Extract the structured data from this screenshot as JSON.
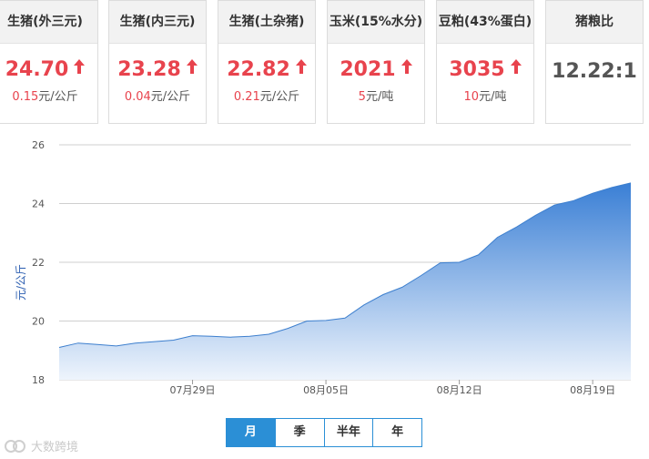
{
  "cards": [
    {
      "name": "生猪(外三元)",
      "price": "24.70",
      "change": "0.15",
      "unit": "元/公斤",
      "trend": "up"
    },
    {
      "name": "生猪(内三元)",
      "price": "23.28",
      "change": "0.04",
      "unit": "元/公斤",
      "trend": "up"
    },
    {
      "name": "生猪(土杂猪)",
      "price": "22.82",
      "change": "0.21",
      "unit": "元/公斤",
      "trend": "up"
    },
    {
      "name": "玉米(15%水分)",
      "price": "2021",
      "change": "5",
      "unit": "元/吨",
      "trend": "up"
    },
    {
      "name": "豆粕(43%蛋白)",
      "price": "3035",
      "change": "10",
      "unit": "元/吨",
      "trend": "up"
    }
  ],
  "ratio_card": {
    "name": "猪粮比",
    "value": "12.22:1"
  },
  "colors": {
    "up": "#e8434d",
    "line": "#3d7fce",
    "fill_top": "#3a7fd5",
    "fill_bottom": "#eef4fc",
    "tab_active": "#2b8fd6"
  },
  "chart_data": {
    "type": "area",
    "ylabel": "元/公斤",
    "ylim": [
      18,
      26
    ],
    "yticks": [
      18,
      20,
      22,
      24,
      26
    ],
    "xticks": [
      {
        "label": "07月29日",
        "index": 7
      },
      {
        "label": "08月05日",
        "index": 14
      },
      {
        "label": "08月12日",
        "index": 21
      },
      {
        "label": "08月19日",
        "index": 28
      }
    ],
    "series": [
      {
        "values": [
          19.1,
          19.25,
          19.2,
          19.15,
          19.25,
          19.3,
          19.35,
          19.5,
          19.48,
          19.45,
          19.48,
          19.55,
          19.75,
          20.0,
          20.02,
          20.1,
          20.55,
          20.9,
          21.15,
          21.55,
          21.98,
          22.0,
          22.25,
          22.85,
          23.2,
          23.6,
          23.95,
          24.1,
          24.35,
          24.55,
          24.7
        ]
      }
    ],
    "grid": true
  },
  "tabs": [
    {
      "label": "月",
      "active": true
    },
    {
      "label": "季",
      "active": false
    },
    {
      "label": "半年",
      "active": false
    },
    {
      "label": "年",
      "active": false
    }
  ],
  "watermark": "大数跨境"
}
